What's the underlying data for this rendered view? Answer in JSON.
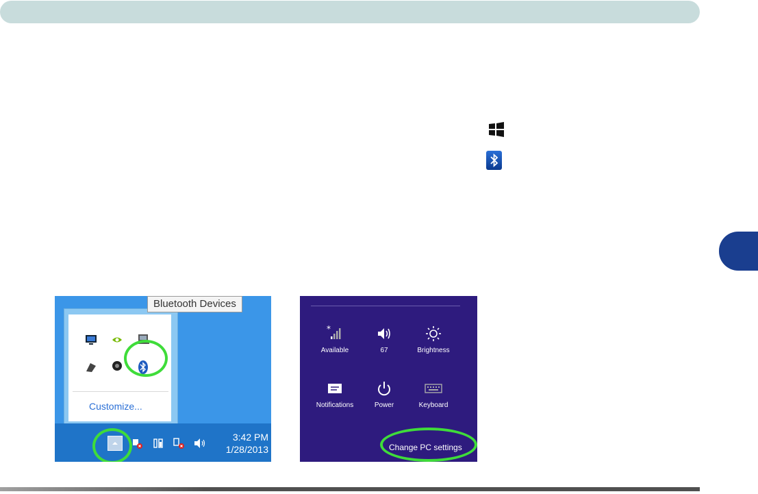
{
  "page": {
    "colors": {
      "header_bar": "#c8dcdc",
      "chapter_tab": "#1a3e8f",
      "highlight_ring": "#3fdc3a",
      "charm_background": "#2e1b7e",
      "taskbar": "#1f74c8"
    }
  },
  "inline_icons": {
    "windows_logo": "windows-logo-icon",
    "bluetooth": "bluetooth-icon"
  },
  "left_screenshot": {
    "tooltip": "Bluetooth Devices",
    "customize_link": "Customize...",
    "tray_icons": [
      "display-icon",
      "nvidia-icon",
      "laptop-icon",
      "tablet-icon",
      "webcam-icon",
      "bluetooth-icon"
    ],
    "taskbar": {
      "time": "3:42 PM",
      "date": "1/28/2013"
    }
  },
  "right_screenshot": {
    "tiles": [
      {
        "label": "Available",
        "icon": "network-signal-icon"
      },
      {
        "label": "67",
        "icon": "volume-icon"
      },
      {
        "label": "Brightness",
        "icon": "brightness-icon"
      },
      {
        "label": "Notifications",
        "icon": "notifications-icon"
      },
      {
        "label": "Power",
        "icon": "power-icon"
      },
      {
        "label": "Keyboard",
        "icon": "keyboard-icon"
      }
    ],
    "change_pc_settings": "Change PC settings"
  }
}
